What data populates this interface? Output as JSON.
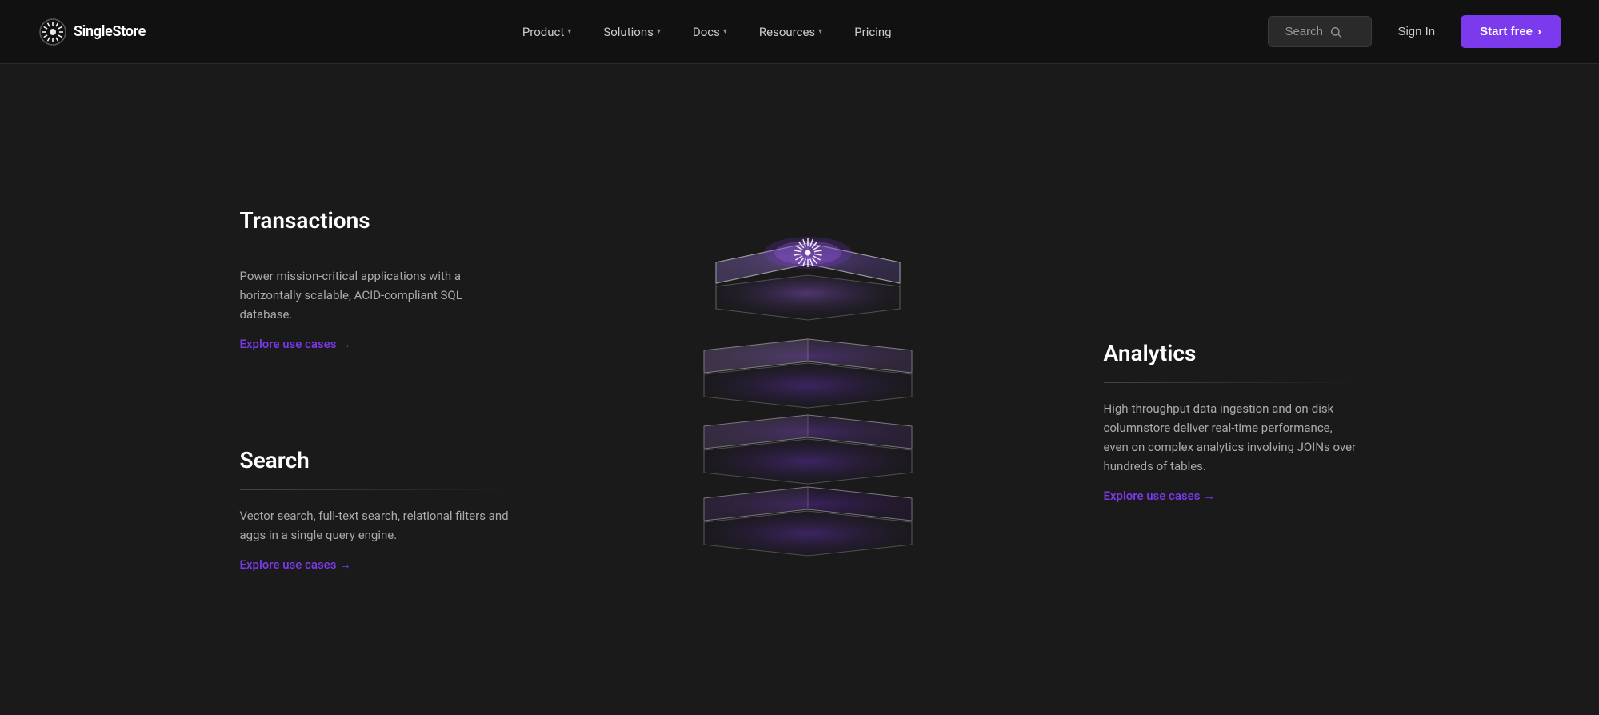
{
  "nav": {
    "logo_text": "SingleStore",
    "links": [
      {
        "id": "product",
        "label": "Product",
        "has_chevron": true
      },
      {
        "id": "solutions",
        "label": "Solutions",
        "has_chevron": true
      },
      {
        "id": "docs",
        "label": "Docs",
        "has_chevron": true
      },
      {
        "id": "resources",
        "label": "Resources",
        "has_chevron": true
      },
      {
        "id": "pricing",
        "label": "Pricing",
        "has_chevron": false
      }
    ],
    "search_placeholder": "Search",
    "signin_label": "Sign In",
    "start_free_label": "Start free"
  },
  "features": {
    "left": [
      {
        "id": "transactions",
        "title": "Transactions",
        "description": "Power mission-critical applications with a horizontally scalable, ACID-compliant SQL database.",
        "cta": "Explore use cases →"
      },
      {
        "id": "search",
        "title": "Search",
        "description": "Vector search, full-text search, relational filters and aggs in a single query engine.",
        "cta": "Explore use cases →"
      }
    ],
    "right": [
      {
        "id": "analytics",
        "title": "Analytics",
        "description": "High-throughput data ingestion and on-disk columnstore deliver real-time performance, even on complex analytics involving JOINs over hundreds of tables.",
        "cta": "Explore use cases →"
      }
    ]
  },
  "colors": {
    "accent": "#7c3aed",
    "bg_dark": "#111111",
    "bg_main": "#1a1a1a",
    "text_primary": "#ffffff",
    "text_secondary": "#aaaaaa"
  }
}
